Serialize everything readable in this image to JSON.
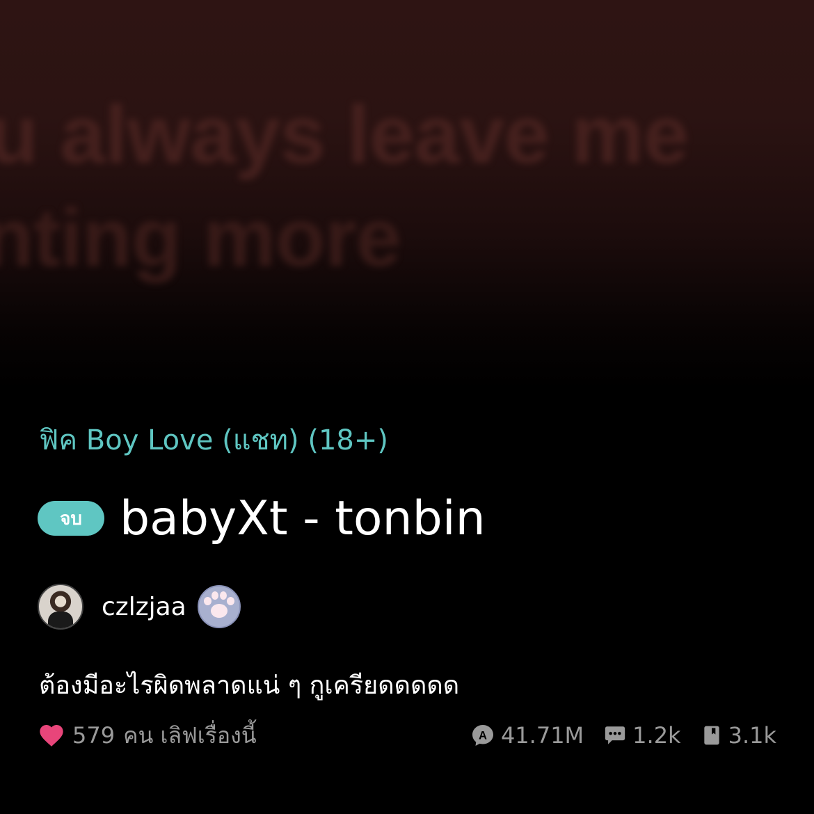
{
  "cover": {
    "line1": "ou always leave me",
    "line2": "anting more"
  },
  "category": "ฟิค Boy Love (แชท) (18+)",
  "status_badge": "จบ",
  "title": "babyXt - tonbin",
  "author": {
    "name": "czlzjaa",
    "badge_icon": "paw-icon"
  },
  "description": "ต้องมีอะไรผิดพลาดแน่ ๆ กูเครียดดดดด",
  "stats": {
    "love_count": "579",
    "love_label": "คน เลิฟเรื่องนี้",
    "views": "41.71M",
    "comments": "1.2k",
    "chapters": "3.1k"
  },
  "colors": {
    "accent": "#5fc6c2",
    "heart": "#e8457a",
    "muted_text": "#9a9a9a"
  }
}
